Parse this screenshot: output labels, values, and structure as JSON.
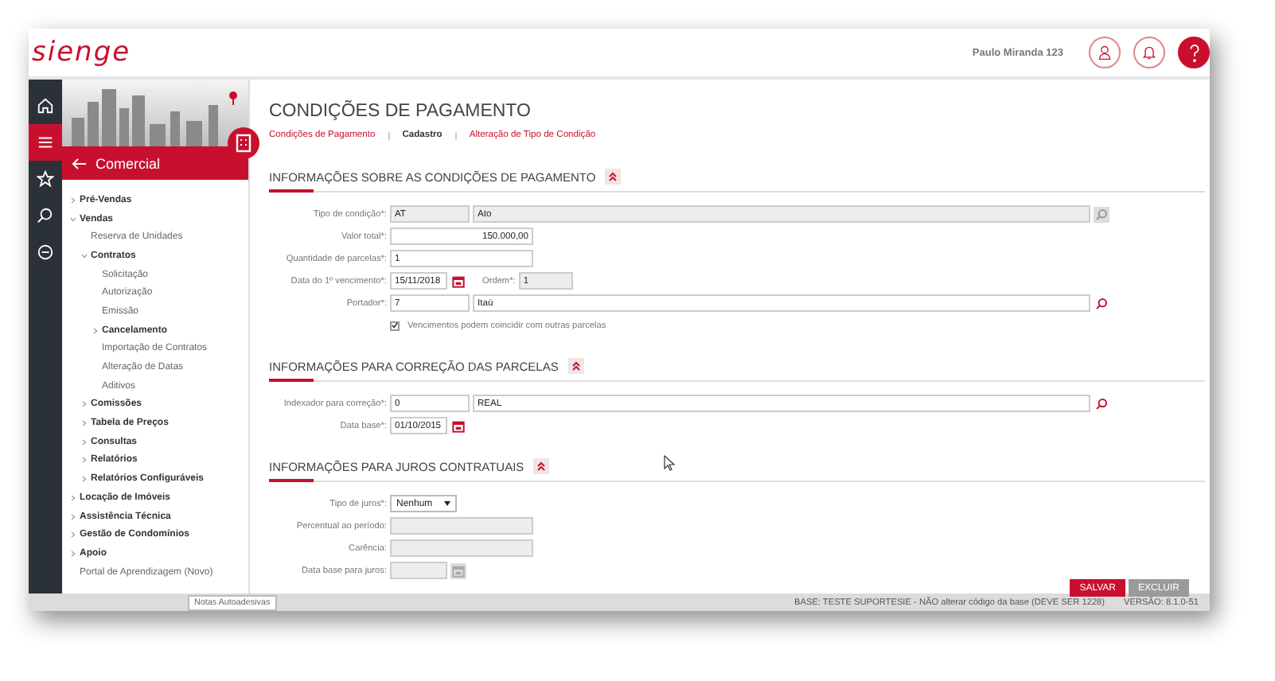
{
  "header": {
    "logo": "sienge",
    "user_name": "Paulo Miranda 123"
  },
  "rail": {
    "items": [
      {
        "kind": "home",
        "selected": false
      },
      {
        "kind": "menu",
        "selected": true
      },
      {
        "kind": "star",
        "selected": false
      },
      {
        "kind": "search",
        "selected": false
      },
      {
        "kind": "minus",
        "selected": false
      }
    ]
  },
  "sidebar": {
    "title": "Comercial",
    "items": [
      {
        "label": "Pré-Vendas",
        "kind": "group",
        "expanded": false
      },
      {
        "label": "Vendas",
        "kind": "group",
        "expanded": true,
        "children": [
          {
            "label": "Reserva de Unidades",
            "kind": "link"
          },
          {
            "label": "Contratos",
            "kind": "group",
            "expanded": true,
            "children": [
              {
                "label": "Solicitação",
                "kind": "link"
              },
              {
                "label": "Autorização",
                "kind": "link"
              },
              {
                "label": "Emissão",
                "kind": "link"
              },
              {
                "label": "Cancelamento",
                "kind": "group",
                "expanded": false
              },
              {
                "label": "Importação de Contratos",
                "kind": "link"
              },
              {
                "label": "Alteração de Datas",
                "kind": "link"
              },
              {
                "label": "Aditivos",
                "kind": "link"
              }
            ]
          },
          {
            "label": "Comissões",
            "kind": "group",
            "expanded": false
          },
          {
            "label": "Tabela de Preços",
            "kind": "group",
            "expanded": false
          },
          {
            "label": "Consultas",
            "kind": "group",
            "expanded": false
          },
          {
            "label": "Relatórios",
            "kind": "group",
            "expanded": false
          },
          {
            "label": "Relatórios Configuráveis",
            "kind": "group",
            "expanded": false
          }
        ]
      },
      {
        "label": "Locação de Imóveis",
        "kind": "group",
        "expanded": false
      },
      {
        "label": "Assistência Técnica",
        "kind": "group",
        "expanded": false
      },
      {
        "label": "Gestão de Condomínios",
        "kind": "group",
        "expanded": false
      },
      {
        "label": "Apoio",
        "kind": "group",
        "expanded": false
      },
      {
        "label": "Portal de Aprendizagem (Novo)",
        "kind": "link"
      }
    ]
  },
  "page": {
    "title": "CONDIÇÕES DE PAGAMENTO",
    "breadcrumbs": [
      {
        "label": "Condições de Pagamento",
        "selected": false
      },
      {
        "label": "Cadastro",
        "selected": true
      },
      {
        "label": "Alteração de Tipo de Condição",
        "selected": false
      }
    ]
  },
  "sections": [
    {
      "title": "INFORMAÇÕES SOBRE AS CONDIÇÕES DE PAGAMENTO",
      "expanded": true,
      "fields": [
        {
          "kind": "lookup",
          "label": "Tipo de condição*:",
          "code": "AT",
          "description": "Ato",
          "disabled": true
        },
        {
          "kind": "amount",
          "label": "Valor total*:",
          "value": "150.000,00",
          "disabled": false
        },
        {
          "kind": "text",
          "label": "Quantidade de parcelas*:",
          "value": "1",
          "disabled": false
        },
        {
          "kind": "date",
          "label": "Data do 1º vencimento*:",
          "value": "15/11/2018",
          "disabled": false,
          "extra": {
            "label": "Ordem*:",
            "value": "1",
            "disabled": true
          }
        },
        {
          "kind": "lookup",
          "label": "Portador*:",
          "code": "7",
          "description": "Itaú",
          "disabled": false
        },
        {
          "kind": "checkbox",
          "label": "Vencimentos podem coincidir com outras parcelas",
          "checked": true
        }
      ]
    },
    {
      "title": "INFORMAÇÕES PARA CORREÇÃO DAS PARCELAS",
      "expanded": true,
      "fields": [
        {
          "kind": "lookup",
          "label": "Indexador para correção*:",
          "code": "0",
          "description": "REAL",
          "disabled": false
        },
        {
          "kind": "date",
          "label": "Data base*:",
          "value": "01/10/2015",
          "disabled": false
        }
      ]
    },
    {
      "title": "INFORMAÇÕES PARA JUROS CONTRATUAIS",
      "expanded": true,
      "fields": [
        {
          "kind": "select",
          "label": "Tipo de juros*:",
          "value": "Nenhum",
          "disabled": false
        },
        {
          "kind": "text",
          "label": "Percentual ao período:",
          "disabled": true
        },
        {
          "kind": "text",
          "label": "Carência:",
          "disabled": true
        },
        {
          "kind": "date",
          "label": "Data base para juros:",
          "disabled": true
        }
      ]
    }
  ],
  "buttons": [
    {
      "label": "SALVAR",
      "disabled": false
    },
    {
      "label": "EXCLUIR",
      "disabled": true
    }
  ],
  "status_bar": {
    "notes_button": "Notas Autoadesivas",
    "base": "BASE: TESTE SUPORTESIE - NÃO alterar código da base (DEVE SER 1228)",
    "version": "VERSÃO: 8.1.0-51"
  }
}
